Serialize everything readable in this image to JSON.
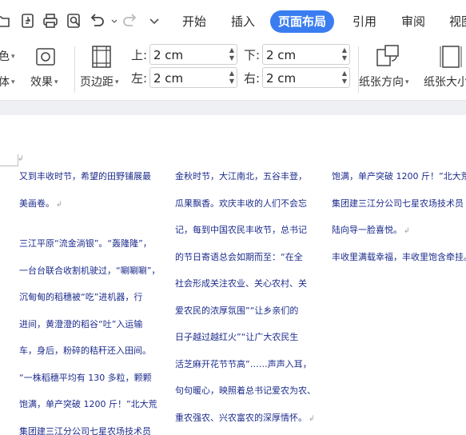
{
  "tabs": {
    "start": "开始",
    "insert": "插入",
    "page_layout": "页面布局",
    "references": "引用",
    "review": "审阅",
    "view": "视图"
  },
  "quick_access_icons": [
    "open-folder-icon",
    "export-pdf-icon",
    "print-icon",
    "print-preview-icon",
    "undo-icon",
    "undo-dropdown-icon",
    "redo-icon",
    "customize-toolbar-icon"
  ],
  "ribbon": {
    "color_label": "色",
    "font_label": "体",
    "effects_label": "效果",
    "margins_label": "页边距",
    "top_label": "上:",
    "top_value": "2 cm",
    "bottom_label": "下:",
    "bottom_value": "2 cm",
    "left_label": "左:",
    "left_value": "2 cm",
    "right_label": "右:",
    "right_value": "2 cm",
    "orientation_label": "纸张方向",
    "size_label": "纸张大小"
  },
  "document": {
    "columns": [
      {
        "lines": [
          "又到丰收时节，希望的田野铺展最",
          "美画卷。",
          "",
          "三江平原“流金淌银”。“轰隆隆”，",
          "一台台联合收割机驶过，“唰唰唰”，",
          "沉甸甸的稻穗被“吃”进机器，行",
          "进间，黄澄澄的稻谷“吐”入运输",
          "车，身后，粉碎的秸秆还入田间。",
          "“一株稻穗平均有 130 多粒，颗颗",
          "饱满，单产突破 1200 斤！”北大荒",
          "集团建三江分公司七星农场技术员"
        ]
      },
      {
        "lines": [
          "金秋时节，大江南北，五谷丰登，",
          "瓜果飘香。欢庆丰收的人们不会忘",
          "记，每到中国农民丰收节，总书记",
          "的节日寄语总会如期而至：“在全",
          "社会形成关注农业、关心农村、关",
          "爱农民的浓厚氛围”“让乡亲们的",
          "日子越过越红火”“让广大农民生",
          "活芝麻开花节节高”……声声入耳，",
          "句句暖心，映照着总书记爱农为农、",
          "重农强农、兴农富农的深厚情怀。"
        ]
      },
      {
        "lines": [
          "饱满，单产突破 1200 斤！”北大荒",
          "集团建三江分公司七星农场技术员",
          "陆向导一脸喜悦。",
          "丰收里满载幸福，丰收里饱含牵挂。"
        ]
      }
    ]
  }
}
